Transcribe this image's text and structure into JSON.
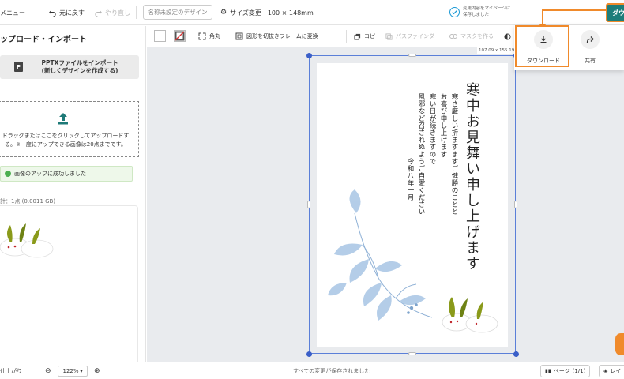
{
  "topbar": {
    "menu_label": "メニュー",
    "undo_label": "元に戻す",
    "redo_label": "やり直し",
    "design_name_placeholder": "名称未設定のデザイン",
    "resize_label": "サイズ変更",
    "size_text": "100 × 148mm",
    "save_status_line1": "変更内容をマイページに",
    "save_status_line2": "保存しました",
    "download_button_label": "ダウ"
  },
  "toolbar": {
    "corner_label": "角丸",
    "crop_frame_label": "図形を切抜きフレームに変換",
    "copy_label": "コピー",
    "pathfinder_label": "パスファインダー",
    "mask_label": "マスクを作る"
  },
  "left_panel": {
    "title": "ップロード・インポート",
    "pptx_line1": "PPTXファイルをインポート",
    "pptx_line2": "(新しくデザインを作成する)",
    "pptx_icon_letter": "P",
    "dropzone_line1": "ドラッグまたはここをクリックしてアップロードす",
    "dropzone_line2": "る。※一度にアップできる画像は20点までです。",
    "success_message": "画像のアップに成功しました",
    "count_text": "計：1点 (0.0011 GB)"
  },
  "canvas": {
    "dimensions_label": "107.09 x 155.19",
    "card_title": "寒中お見舞い申し上げます",
    "body_lines": [
      "寒さ厳しい折ますますご健勝のことと",
      "お喜び申し上げます",
      "寒い日が続きますので",
      "風邪など召されぬようご自愛ください",
      "令和八年一月"
    ]
  },
  "download_popup": {
    "download_label": "ダウンロード",
    "share_label": "共有"
  },
  "bottombar": {
    "finish_label": "仕上がり",
    "zoom_value": "122%",
    "status_text": "すべての変更が保存されました",
    "page_label": "ページ",
    "page_count": "(1/1)",
    "layer_label": "レイ"
  },
  "colors": {
    "brand_teal": "#1d7d7a",
    "highlight_orange": "#f08a2b",
    "selection_blue": "#3b5fc8",
    "success_green": "#4caf50",
    "upload_icon_teal": "#1e7a78",
    "save_check_blue": "#1c9ad6"
  },
  "icons": [
    "undo-icon",
    "redo-icon",
    "gear-icon",
    "check-circle-icon",
    "pptx-file-icon",
    "upload-icon",
    "success-check-icon",
    "chevron-left-icon",
    "no-fill-icon",
    "corner-icon",
    "crop-frame-icon",
    "copy-icon",
    "pathfinder-icon",
    "mask-icon",
    "download-icon",
    "share-icon",
    "zoom-out-icon",
    "zoom-in-icon",
    "book-icon",
    "layers-icon"
  ]
}
